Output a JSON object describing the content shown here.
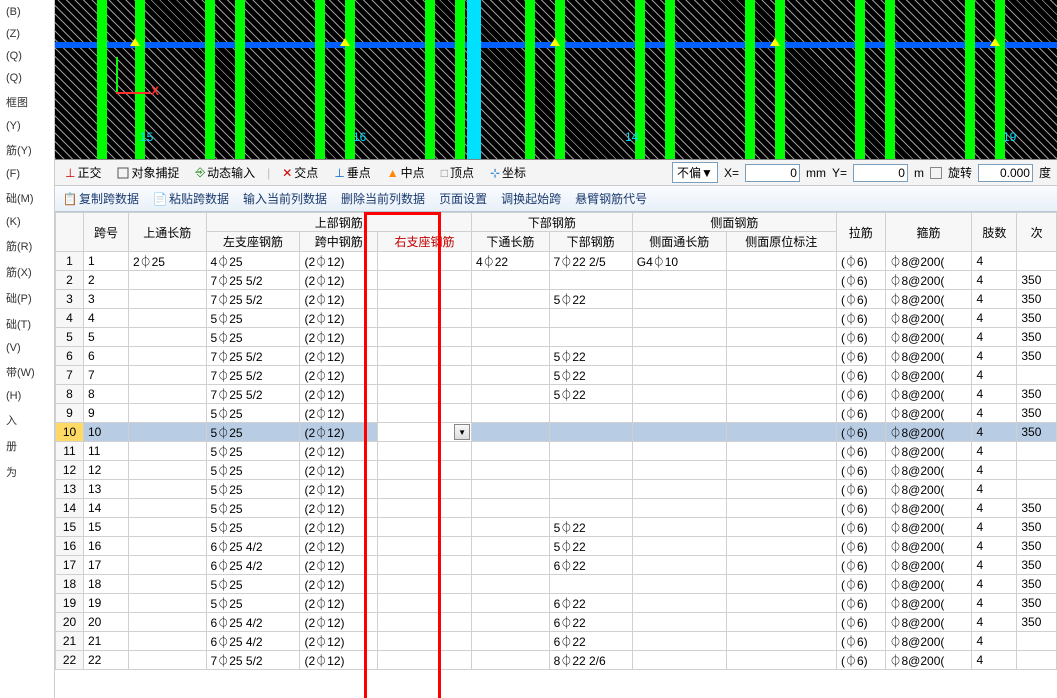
{
  "left_panel": {
    "items": [
      "(B)",
      "(Z)",
      "(Q)",
      "(Q)",
      "框图",
      "(Y)",
      "筋(Y)",
      "(F)",
      "础(M)",
      "(K)",
      "筋(R)",
      "筋(X)",
      "础(P)",
      "础(T)",
      "(V)",
      "带(W)",
      "(H)",
      "入",
      "册",
      "为"
    ]
  },
  "cad": {
    "grid_numbers": [
      "15",
      "16",
      "14",
      "19"
    ],
    "axis_x": "X"
  },
  "statusbar": {
    "ortho": "正交",
    "snap": "对象捕捉",
    "dyn": "动态输入",
    "int": "交点",
    "perp": "垂点",
    "mid": "中点",
    "vertex": "顶点",
    "coord": "坐标",
    "offset_mode": "不偏▼",
    "x_label": "X=",
    "x_val": "0",
    "unit1": "mm",
    "y_label": "Y=",
    "y_val": "0",
    "unit2": "m",
    "rotate": "旋转",
    "rot_val": "0.000",
    "deg": "度"
  },
  "toolbar": {
    "copy": "复制跨数据",
    "paste": "粘贴跨数据",
    "input_col": "输入当前列数据",
    "del_col": "删除当前列数据",
    "page": "页面设置",
    "adjust": "调换起始跨",
    "cantilever": "悬臂钢筋代号"
  },
  "headers": {
    "span_no": "跨号",
    "top_thru": "上通长筋",
    "top_rebar": "上部钢筋",
    "left_sup": "左支座钢筋",
    "mid_span": "跨中钢筋",
    "right_sup": "右支座钢筋",
    "bot_rebar": "下部钢筋",
    "bot_thru": "下通长筋",
    "bot": "下部钢筋",
    "side_rebar": "侧面钢筋",
    "side_thru": "侧面通长筋",
    "side_mark": "侧面原位标注",
    "tie": "拉筋",
    "stirrup": "箍筋",
    "legs": "肢数",
    "next": "次"
  },
  "rows": [
    {
      "n": "1",
      "span": "1",
      "top_thru": "2⏀25",
      "left": "4⏀25",
      "mid": "(2⏀12)",
      "right": "",
      "bot_thru": "4⏀22",
      "bot": "7⏀22 2/5",
      "side_thru": "G4⏀10",
      "side_mark": "",
      "tie": "(⏀6)",
      "stirrup": "⏀8@200(",
      "legs": "4",
      "next": ""
    },
    {
      "n": "2",
      "span": "2",
      "top_thru": "",
      "left": "7⏀25 5/2",
      "mid": "(2⏀12)",
      "right": "",
      "bot_thru": "",
      "bot": "",
      "side_thru": "",
      "side_mark": "",
      "tie": "(⏀6)",
      "stirrup": "⏀8@200(",
      "legs": "4",
      "next": "350"
    },
    {
      "n": "3",
      "span": "3",
      "top_thru": "",
      "left": "7⏀25 5/2",
      "mid": "(2⏀12)",
      "right": "",
      "bot_thru": "",
      "bot": "5⏀22",
      "side_thru": "",
      "side_mark": "",
      "tie": "(⏀6)",
      "stirrup": "⏀8@200(",
      "legs": "4",
      "next": "350"
    },
    {
      "n": "4",
      "span": "4",
      "top_thru": "",
      "left": "5⏀25",
      "mid": "(2⏀12)",
      "right": "",
      "bot_thru": "",
      "bot": "",
      "side_thru": "",
      "side_mark": "",
      "tie": "(⏀6)",
      "stirrup": "⏀8@200(",
      "legs": "4",
      "next": "350"
    },
    {
      "n": "5",
      "span": "5",
      "top_thru": "",
      "left": "5⏀25",
      "mid": "(2⏀12)",
      "right": "",
      "bot_thru": "",
      "bot": "",
      "side_thru": "",
      "side_mark": "",
      "tie": "(⏀6)",
      "stirrup": "⏀8@200(",
      "legs": "4",
      "next": "350"
    },
    {
      "n": "6",
      "span": "6",
      "top_thru": "",
      "left": "7⏀25 5/2",
      "mid": "(2⏀12)",
      "right": "",
      "bot_thru": "",
      "bot": "5⏀22",
      "side_thru": "",
      "side_mark": "",
      "tie": "(⏀6)",
      "stirrup": "⏀8@200(",
      "legs": "4",
      "next": "350"
    },
    {
      "n": "7",
      "span": "7",
      "top_thru": "",
      "left": "7⏀25 5/2",
      "mid": "(2⏀12)",
      "right": "",
      "bot_thru": "",
      "bot": "5⏀22",
      "side_thru": "",
      "side_mark": "",
      "tie": "(⏀6)",
      "stirrup": "⏀8@200(",
      "legs": "4",
      "next": ""
    },
    {
      "n": "8",
      "span": "8",
      "top_thru": "",
      "left": "7⏀25 5/2",
      "mid": "(2⏀12)",
      "right": "",
      "bot_thru": "",
      "bot": "5⏀22",
      "side_thru": "",
      "side_mark": "",
      "tie": "(⏀6)",
      "stirrup": "⏀8@200(",
      "legs": "4",
      "next": "350"
    },
    {
      "n": "9",
      "span": "9",
      "top_thru": "",
      "left": "5⏀25",
      "mid": "(2⏀12)",
      "right": "",
      "bot_thru": "",
      "bot": "",
      "side_thru": "",
      "side_mark": "",
      "tie": "(⏀6)",
      "stirrup": "⏀8@200(",
      "legs": "4",
      "next": "350"
    },
    {
      "n": "10",
      "span": "10",
      "top_thru": "",
      "left": "5⏀25",
      "mid": "(2⏀12)",
      "right": "",
      "bot_thru": "",
      "bot": "",
      "side_thru": "",
      "side_mark": "",
      "tie": "(⏀6)",
      "stirrup": "⏀8@200(",
      "legs": "4",
      "next": "350",
      "sel": true,
      "dd": true
    },
    {
      "n": "11",
      "span": "11",
      "top_thru": "",
      "left": "5⏀25",
      "mid": "(2⏀12)",
      "right": "",
      "bot_thru": "",
      "bot": "",
      "side_thru": "",
      "side_mark": "",
      "tie": "(⏀6)",
      "stirrup": "⏀8@200(",
      "legs": "4",
      "next": ""
    },
    {
      "n": "12",
      "span": "12",
      "top_thru": "",
      "left": "5⏀25",
      "mid": "(2⏀12)",
      "right": "",
      "bot_thru": "",
      "bot": "",
      "side_thru": "",
      "side_mark": "",
      "tie": "(⏀6)",
      "stirrup": "⏀8@200(",
      "legs": "4",
      "next": ""
    },
    {
      "n": "13",
      "span": "13",
      "top_thru": "",
      "left": "5⏀25",
      "mid": "(2⏀12)",
      "right": "",
      "bot_thru": "",
      "bot": "",
      "side_thru": "",
      "side_mark": "",
      "tie": "(⏀6)",
      "stirrup": "⏀8@200(",
      "legs": "4",
      "next": ""
    },
    {
      "n": "14",
      "span": "14",
      "top_thru": "",
      "left": "5⏀25",
      "mid": "(2⏀12)",
      "right": "",
      "bot_thru": "",
      "bot": "",
      "side_thru": "",
      "side_mark": "",
      "tie": "(⏀6)",
      "stirrup": "⏀8@200(",
      "legs": "4",
      "next": "350"
    },
    {
      "n": "15",
      "span": "15",
      "top_thru": "",
      "left": "5⏀25",
      "mid": "(2⏀12)",
      "right": "",
      "bot_thru": "",
      "bot": "5⏀22",
      "side_thru": "",
      "side_mark": "",
      "tie": "(⏀6)",
      "stirrup": "⏀8@200(",
      "legs": "4",
      "next": "350"
    },
    {
      "n": "16",
      "span": "16",
      "top_thru": "",
      "left": "6⏀25 4/2",
      "mid": "(2⏀12)",
      "right": "",
      "bot_thru": "",
      "bot": "5⏀22",
      "side_thru": "",
      "side_mark": "",
      "tie": "(⏀6)",
      "stirrup": "⏀8@200(",
      "legs": "4",
      "next": "350"
    },
    {
      "n": "17",
      "span": "17",
      "top_thru": "",
      "left": "6⏀25 4/2",
      "mid": "(2⏀12)",
      "right": "",
      "bot_thru": "",
      "bot": "6⏀22",
      "side_thru": "",
      "side_mark": "",
      "tie": "(⏀6)",
      "stirrup": "⏀8@200(",
      "legs": "4",
      "next": "350"
    },
    {
      "n": "18",
      "span": "18",
      "top_thru": "",
      "left": "5⏀25",
      "mid": "(2⏀12)",
      "right": "",
      "bot_thru": "",
      "bot": "",
      "side_thru": "",
      "side_mark": "",
      "tie": "(⏀6)",
      "stirrup": "⏀8@200(",
      "legs": "4",
      "next": "350"
    },
    {
      "n": "19",
      "span": "19",
      "top_thru": "",
      "left": "5⏀25",
      "mid": "(2⏀12)",
      "right": "",
      "bot_thru": "",
      "bot": "6⏀22",
      "side_thru": "",
      "side_mark": "",
      "tie": "(⏀6)",
      "stirrup": "⏀8@200(",
      "legs": "4",
      "next": "350"
    },
    {
      "n": "20",
      "span": "20",
      "top_thru": "",
      "left": "6⏀25 4/2",
      "mid": "(2⏀12)",
      "right": "",
      "bot_thru": "",
      "bot": "6⏀22",
      "side_thru": "",
      "side_mark": "",
      "tie": "(⏀6)",
      "stirrup": "⏀8@200(",
      "legs": "4",
      "next": "350"
    },
    {
      "n": "21",
      "span": "21",
      "top_thru": "",
      "left": "6⏀25 4/2",
      "mid": "(2⏀12)",
      "right": "",
      "bot_thru": "",
      "bot": "6⏀22",
      "side_thru": "",
      "side_mark": "",
      "tie": "(⏀6)",
      "stirrup": "⏀8@200(",
      "legs": "4",
      "next": ""
    },
    {
      "n": "22",
      "span": "22",
      "top_thru": "",
      "left": "7⏀25 5/2",
      "mid": "(2⏀12)",
      "right": "",
      "bot_thru": "",
      "bot": "8⏀22 2/6",
      "side_thru": "",
      "side_mark": "",
      "tie": "(⏀6)",
      "stirrup": "⏀8@200(",
      "legs": "4",
      "next": ""
    }
  ]
}
